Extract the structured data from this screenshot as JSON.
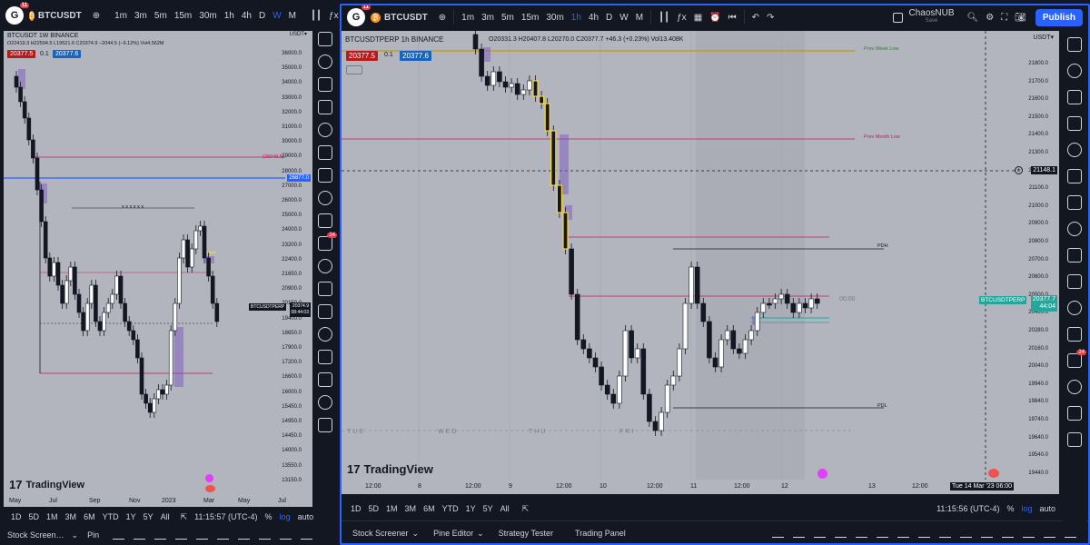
{
  "left": {
    "logo_text": "G",
    "logo_badge": "11",
    "symbol": "BTCUSDT",
    "intervals": [
      "1m",
      "3m",
      "5m",
      "15m",
      "30m",
      "1h",
      "4h",
      "D",
      "W",
      "M"
    ],
    "active_interval": "W",
    "header": "BTCUSDT  1W  BINANCE",
    "ohlc": "O22419.3  H22594.5  L19521.6  C20374.9  −2044.5 (−9.12%)  Vol4.562M",
    "bid": "20377.5",
    "spread": "0.1",
    "ask": "20377.6",
    "axis_currency": "USDT▾",
    "price_ticks": [
      "36000.0",
      "35000.0",
      "34000.0",
      "33000.0",
      "32000.0",
      "31000.0",
      "30000.0",
      "29000.0",
      "28000.0",
      "27000.0",
      "26000.0",
      "25000.0",
      "24000.0",
      "23200.0",
      "22400.0",
      "21650.0",
      "20900.0",
      "20150.0",
      "19400.0",
      "18650.0",
      "17900.0",
      "17200.0",
      "16600.0",
      "16000.0",
      "15450.0",
      "14950.0",
      "14450.0",
      "14000.0",
      "13550.0",
      "13150.0"
    ],
    "blue_tag": "26877.0",
    "red_line_label": "(28048.5)",
    "current_tag_name": "BTCUSDTPERP",
    "current_tag_price": "20374.9",
    "current_tag_time": "08:44:03",
    "xx_label": "x x x x x x",
    "time_ticks": [
      "May",
      "Jul",
      "Sep",
      "Nov",
      "2023",
      "Mar",
      "May",
      "Jul"
    ],
    "bottom_ranges": [
      "1D",
      "5D",
      "1M",
      "3M",
      "6M",
      "YTD",
      "1Y",
      "5Y",
      "All"
    ],
    "clock": "11:15:57 (UTC-4)",
    "pct": "%",
    "log": "log",
    "auto": "auto",
    "tab1": "Stock Screen…",
    "tab2": "Pin",
    "tv_brand": "TradingView"
  },
  "right": {
    "logo_text": "G",
    "logo_badge": "11",
    "symbol": "BTCUSDT",
    "intervals": [
      "1m",
      "3m",
      "5m",
      "15m",
      "30m",
      "1h",
      "4h",
      "D",
      "W",
      "M"
    ],
    "active_interval": "1h",
    "user": "ChaosNUB",
    "user_sub": "Save",
    "publish": "Publish",
    "header": "BTCUSDTPERP  1h  BINANCE",
    "ohlc": "O20331.3  H20407.8  L20270.0  C20377.7  +46.3 (+0.23%)  Vol13.408K",
    "bid": "20377.5",
    "spread": "0.1",
    "ask": "20377.6",
    "axis_currency": "USDT▾",
    "price_ticks": [
      "21800.0",
      "21700.0",
      "21600.0",
      "21500.0",
      "21400.0",
      "21300.0",
      "21200.0",
      "21100.0",
      "21000.0",
      "20900.0",
      "20800.0",
      "20700.0",
      "20600.0",
      "20500.0",
      "20400.0",
      "20280.0",
      "20160.0",
      "20040.0",
      "19940.0",
      "19840.0",
      "19740.0",
      "19640.0",
      "19540.0",
      "19440.0",
      "19358.0"
    ],
    "crosshair_price": "21148.1",
    "current_tag_name": "BTCUSDTPERP",
    "current_tag_price": "20377.7",
    "current_tag_time": "44:04",
    "countdown": "00:00",
    "lbl_prev_week_low": "Prev Week Low",
    "lbl_prev_month_low": "Prev Month Low",
    "lbl_pdh": "PDH",
    "lbl_pdl": "PDL",
    "days": [
      "TUE",
      "WED",
      "THU",
      "FRI"
    ],
    "time_ticks": [
      "12:00",
      "8",
      "12:00",
      "9",
      "12:00",
      "10",
      "12:00",
      "11",
      "12:00",
      "12",
      "13",
      "12:00"
    ],
    "crosshair_time": "Tue 14 Mar '23  06:00",
    "bottom_ranges": [
      "1D",
      "5D",
      "1M",
      "3M",
      "6M",
      "YTD",
      "1Y",
      "5Y",
      "All"
    ],
    "clock": "11:15:56 (UTC-4)",
    "pct": "%",
    "log": "log",
    "auto": "auto",
    "tabs": [
      "Stock Screener",
      "Pine Editor",
      "Strategy Tester",
      "Trading Panel"
    ],
    "tv_brand": "TradingView",
    "right_badge": "24"
  },
  "left_sidebar_badge": "24",
  "colors": {
    "bg": "#131722",
    "chart_bg": "#b2b5be",
    "up": "#26a69a",
    "up_body": "#ffffff",
    "blue_line": "#2962ff",
    "red_line": "#c2185b",
    "accent": "#2962ff",
    "badge": "#f23645"
  }
}
